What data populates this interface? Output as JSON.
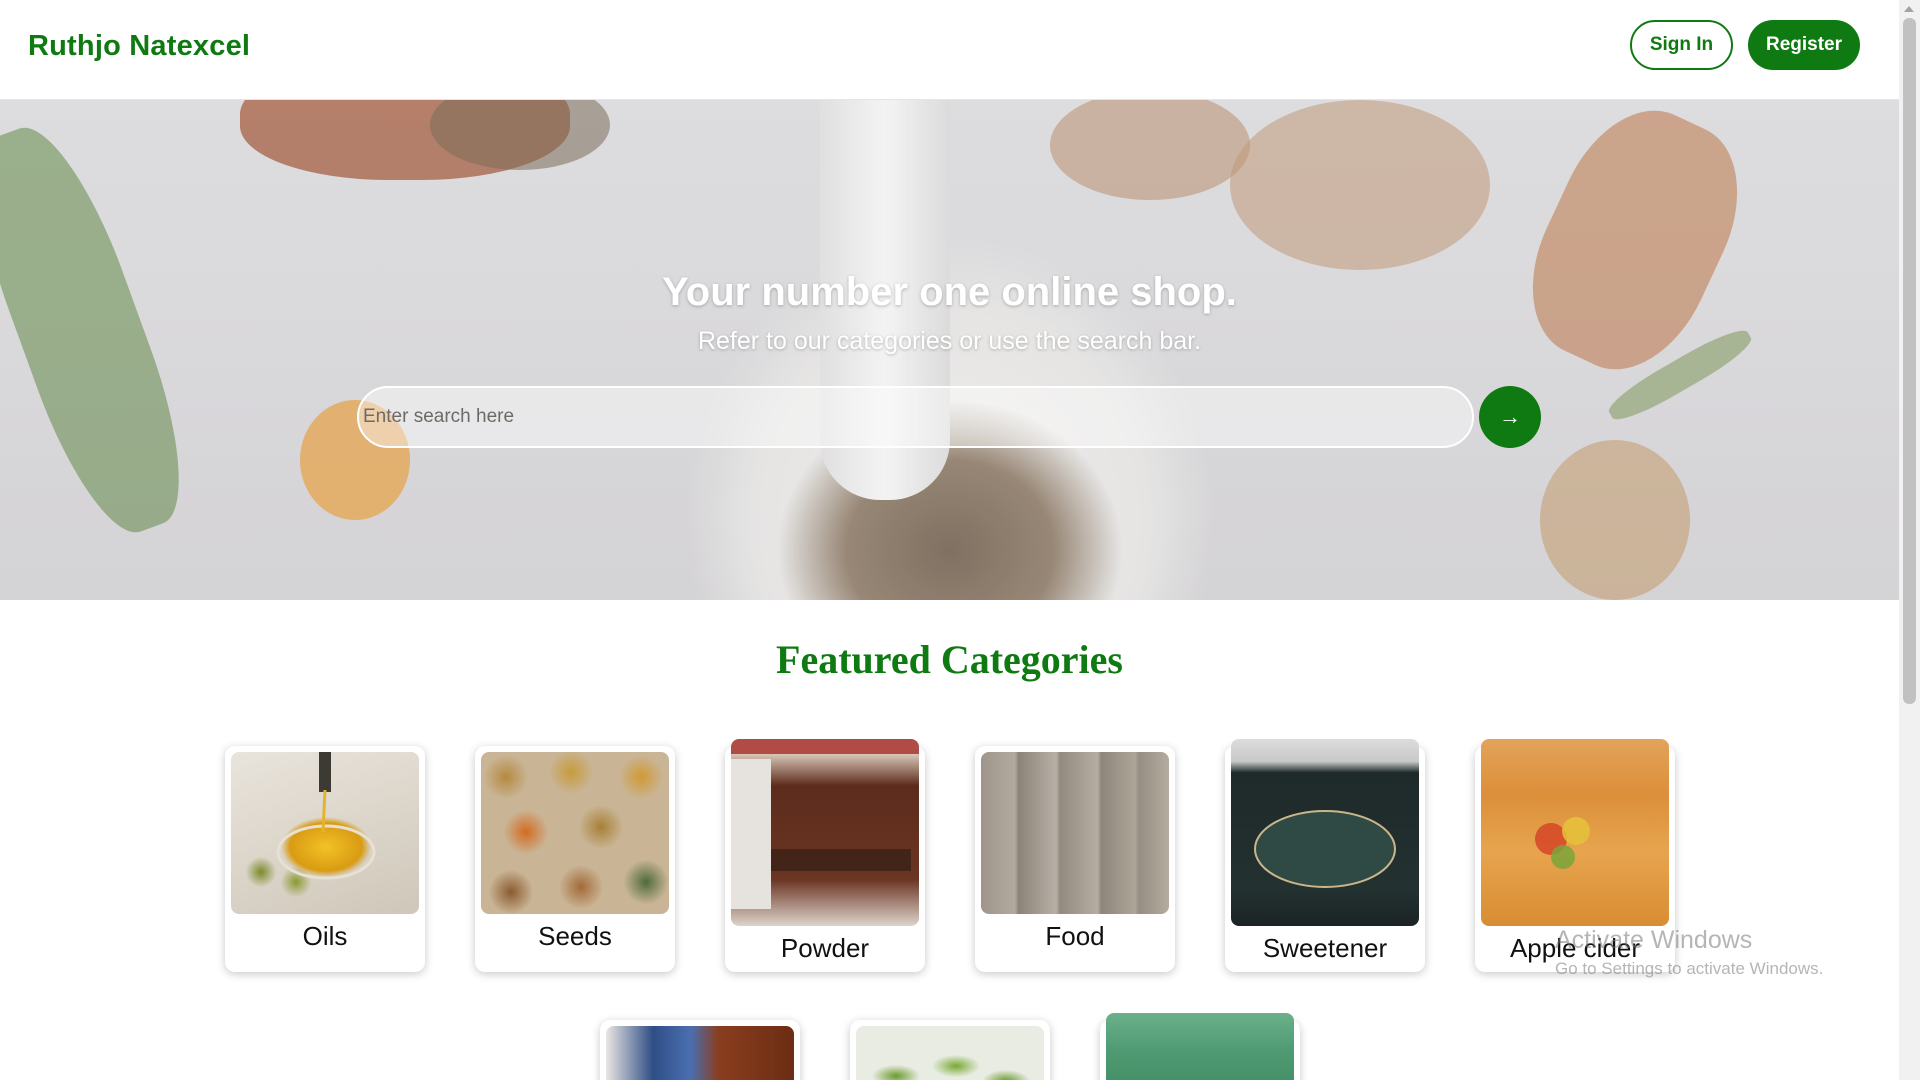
{
  "header": {
    "brand": "Ruthjo Natexcel",
    "sign_in_label": "Sign In",
    "register_label": "Register"
  },
  "hero": {
    "title": "Your number one online shop.",
    "subtitle": "Refer to our categories or use the search bar.",
    "search_placeholder": "Enter search here",
    "search_button_icon": "→"
  },
  "featured": {
    "title": "Featured Categories",
    "categories": [
      {
        "label": "Oils",
        "icon": "oil-bowl-image"
      },
      {
        "label": "Seeds",
        "icon": "seeds-sacks-image"
      },
      {
        "label": "Powder",
        "icon": "cinnamon-powder-jar-image"
      },
      {
        "label": "Food",
        "icon": "food-bags-image"
      },
      {
        "label": "Sweetener",
        "icon": "molasses-jar-image"
      },
      {
        "label": "Apple cider",
        "icon": "apple-cider-bottle-image"
      }
    ],
    "row2": [
      {
        "icon": "boxed-product-image"
      },
      {
        "icon": "green-capsules-image"
      },
      {
        "icon": "green-tins-image"
      }
    ]
  },
  "system": {
    "watermark_title": "Activate Windows",
    "watermark_sub": "Go to Settings to activate Windows."
  },
  "colors": {
    "brand_green": "#0f7a12",
    "white": "#ffffff"
  }
}
